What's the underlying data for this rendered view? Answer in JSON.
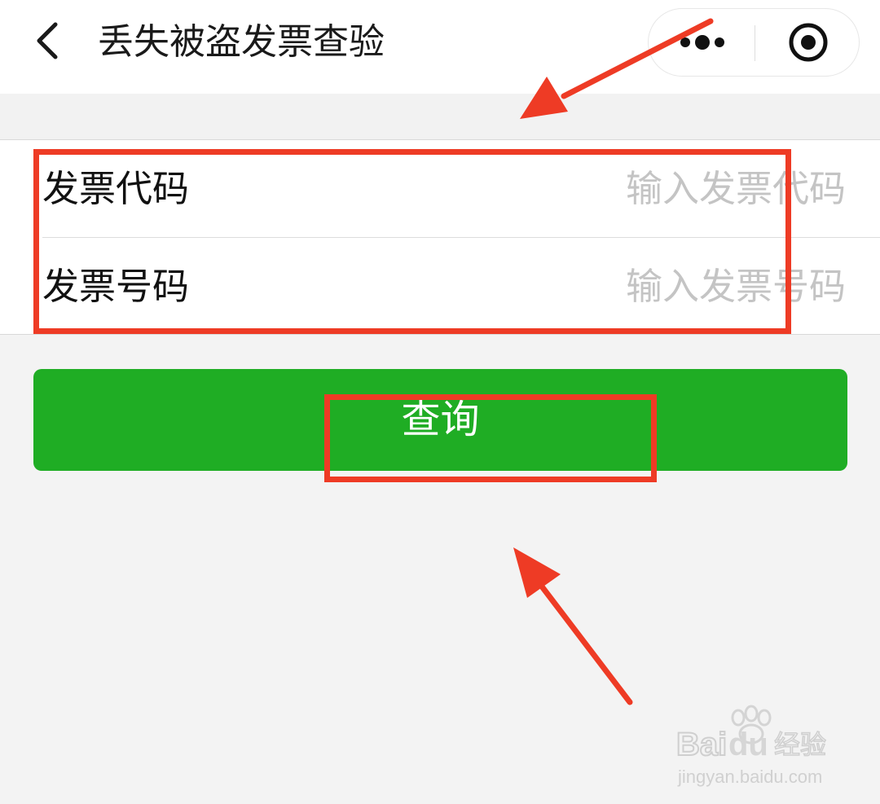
{
  "navbar": {
    "title": "丢失被盗发票查验",
    "back_icon": "chevron-left-icon",
    "more_icon": "more-dots-icon",
    "close_icon": "target-close-icon"
  },
  "form": {
    "fields": [
      {
        "label": "发票代码",
        "placeholder": "输入发票代码"
      },
      {
        "label": "发票号码",
        "placeholder": "输入发票号码"
      }
    ]
  },
  "query_button": {
    "label": "查询"
  },
  "colors": {
    "accent": "#1fad24",
    "annotation": "#ee3b25",
    "background": "#f3f3f3"
  },
  "watermark": {
    "brand": "Baidu经验",
    "url": "jingyan.baidu.com"
  }
}
